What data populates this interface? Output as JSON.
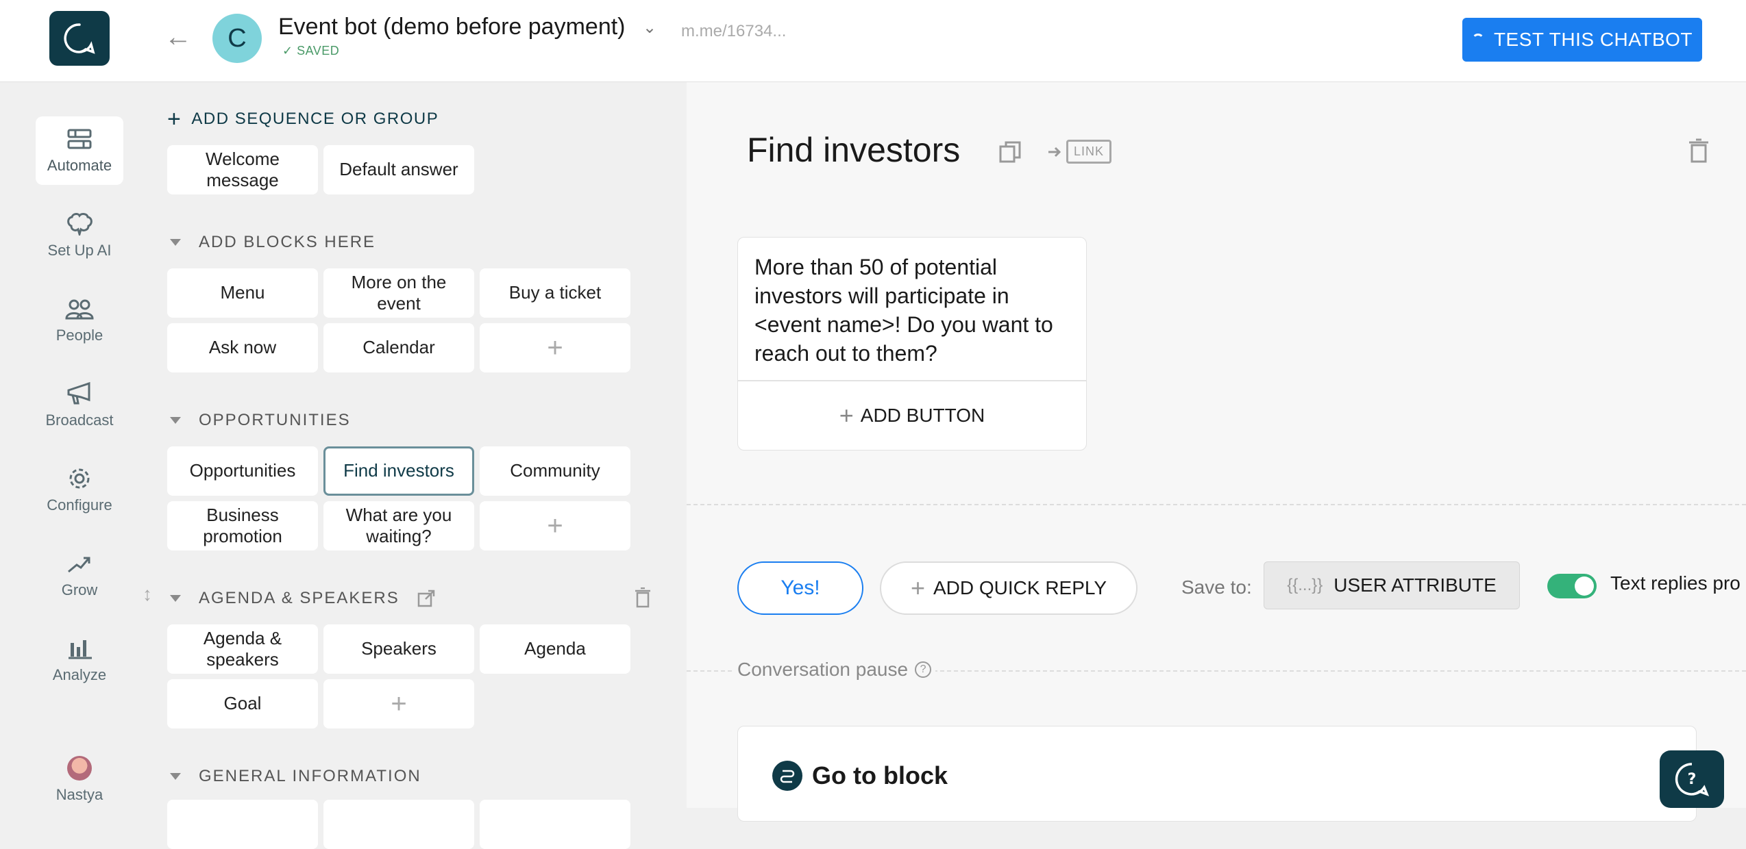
{
  "header": {
    "bot_avatar_letter": "C",
    "bot_name": "Event bot (demo before payment)",
    "save_status": "SAVED",
    "messenger_link": "m.me/16734...",
    "test_button": "TEST THIS CHATBOT"
  },
  "nav": {
    "items": [
      {
        "label": "Automate",
        "icon": "automate-icon",
        "active": true
      },
      {
        "label": "Set Up AI",
        "icon": "ai-brain-icon"
      },
      {
        "label": "People",
        "icon": "people-icon"
      },
      {
        "label": "Broadcast",
        "icon": "megaphone-icon"
      },
      {
        "label": "Configure",
        "icon": "gear-icon"
      },
      {
        "label": "Grow",
        "icon": "grow-icon"
      },
      {
        "label": "Analyze",
        "icon": "bar-chart-icon"
      }
    ],
    "user_name": "Nastya"
  },
  "blocks": {
    "add_sequence": "ADD SEQUENCE OR GROUP",
    "top_cards": [
      "Welcome message",
      "Default answer"
    ],
    "groups": [
      {
        "name": "ADD BLOCKS HERE",
        "cards": [
          "Menu",
          "More on the event",
          "Buy a ticket",
          "Ask now",
          "Calendar"
        ]
      },
      {
        "name": "OPPORTUNITIES",
        "cards": [
          "Opportunities",
          "Find investors",
          "Community",
          "Business promotion",
          "What are you waiting?"
        ]
      },
      {
        "name": "AGENDA & SPEAKERS",
        "cards": [
          "Agenda & speakers",
          "Speakers",
          "Agenda",
          "Goal"
        ]
      },
      {
        "name": "GENERAL INFORMATION",
        "cards": []
      }
    ],
    "add_card": "+"
  },
  "editor": {
    "block_title": "Find investors",
    "link_label": "LINK",
    "message_text": "More than 50 of potential investors will participate in <event name>! Do you want to reach out to them?",
    "add_button": "ADD BUTTON",
    "quick_reply": "Yes!",
    "add_quick_reply": "ADD QUICK REPLY",
    "save_to_label": "Save to:",
    "attr_brace": "{{...}}",
    "user_attribute": "USER ATTRIBUTE",
    "text_replies_label": "Text replies pro",
    "conversation_pause": "Conversation pause",
    "goto_block": "Go to block"
  },
  "colors": {
    "brand": "#0f3a47",
    "accent": "#1a7ef0",
    "toggle_on": "#34b27a"
  }
}
